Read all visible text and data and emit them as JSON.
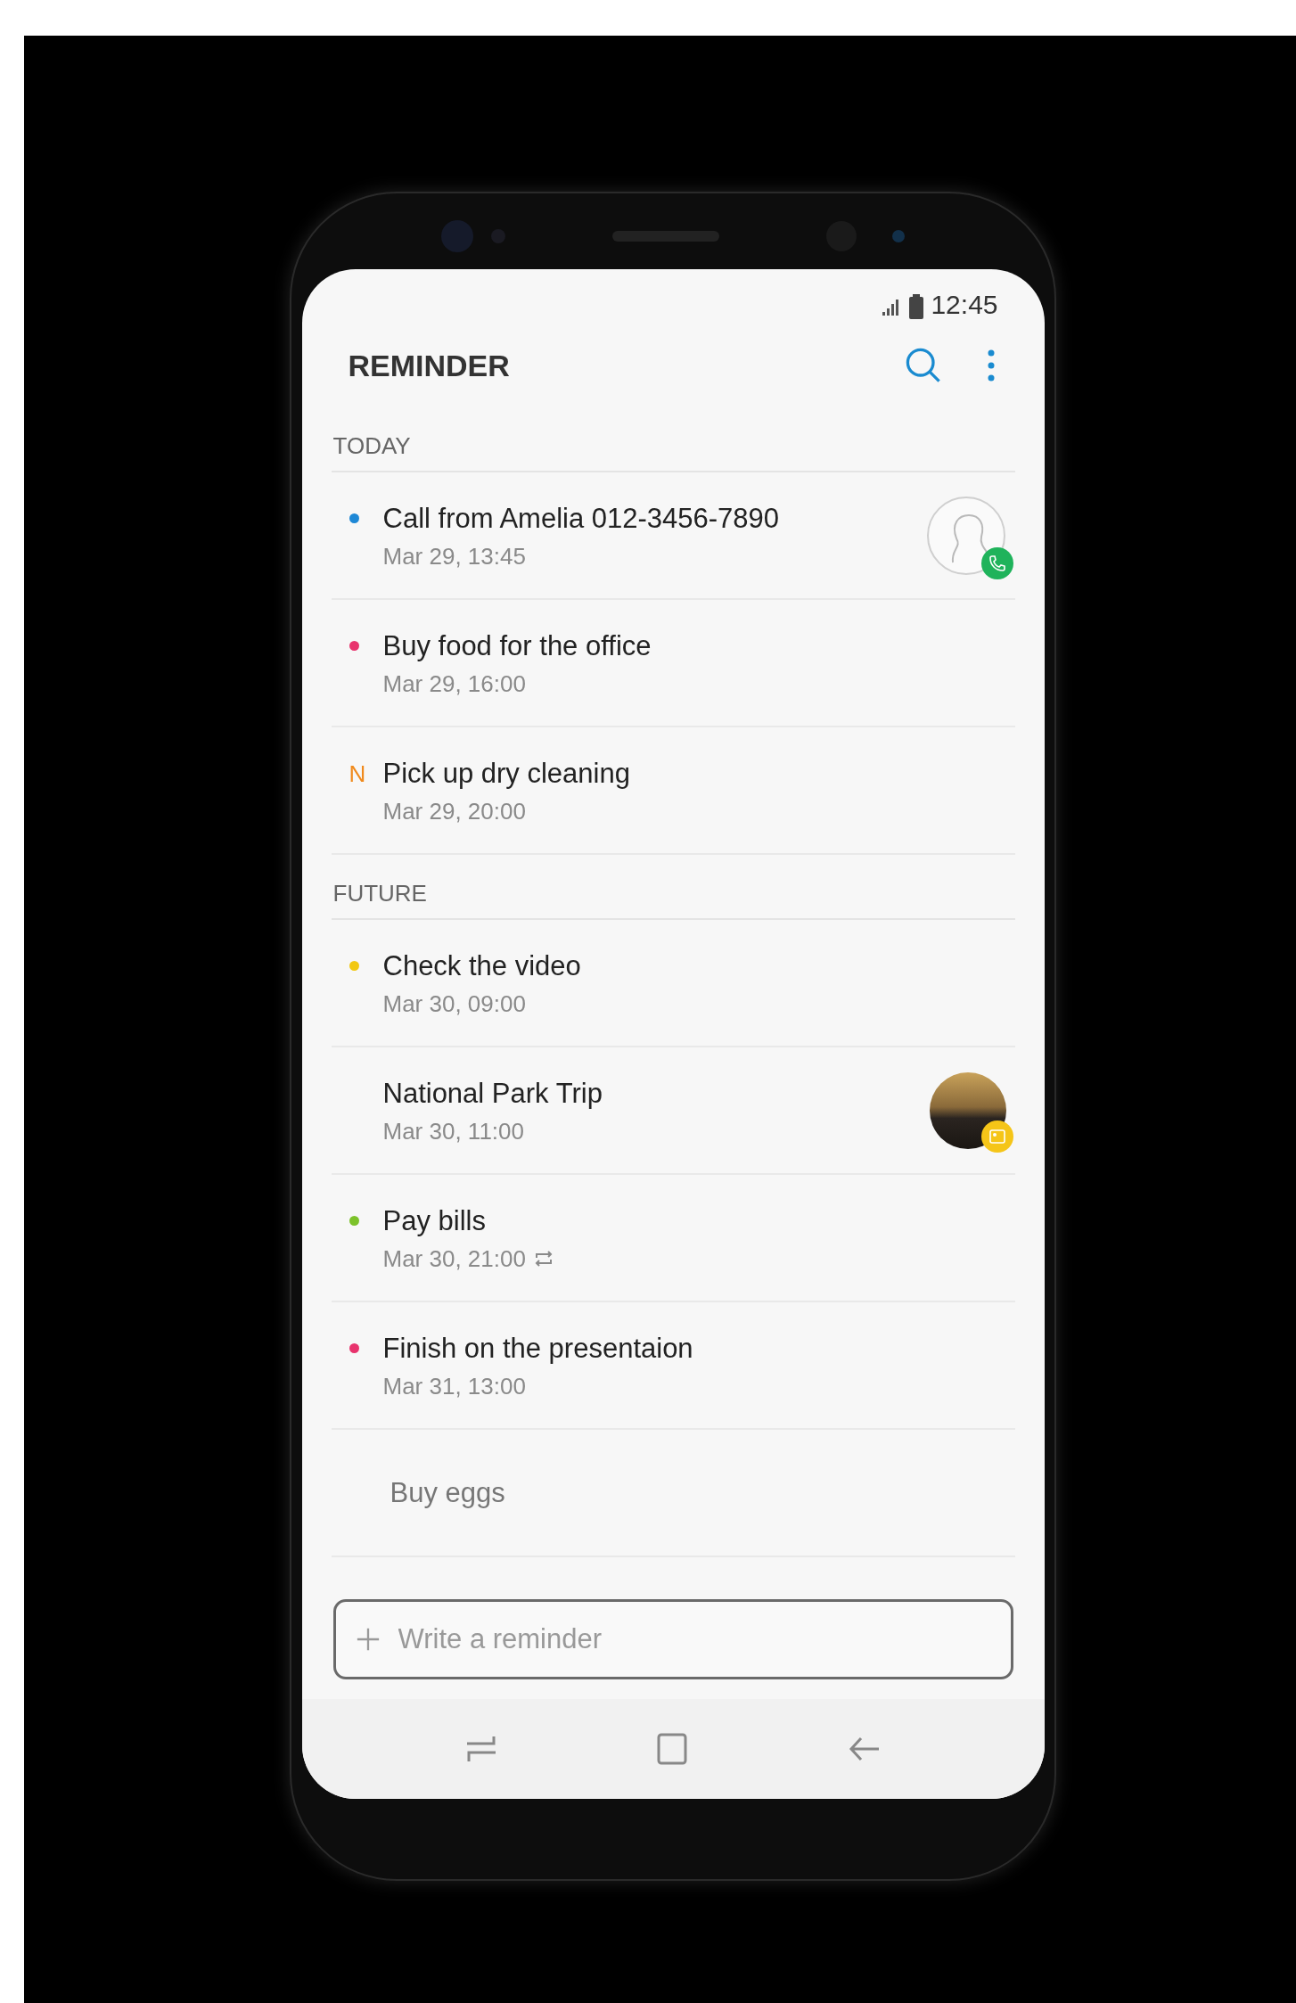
{
  "status_bar": {
    "time": "12:45"
  },
  "app_bar": {
    "title": "REMINDER"
  },
  "sections": [
    {
      "label": "TODAY",
      "items": [
        {
          "title": "Call from Amelia 012-3456-7890",
          "date": "Mar 29, 13:45",
          "marker": {
            "kind": "dot",
            "color": "#1e88d6"
          },
          "attachment": {
            "kind": "contact"
          },
          "repeat": false,
          "faded": false
        },
        {
          "title": "Buy food for the office",
          "date": "Mar 29, 16:00",
          "marker": {
            "kind": "dot",
            "color": "#e8336d"
          },
          "repeat": false,
          "faded": false
        },
        {
          "title": "Pick up dry cleaning",
          "date": "Mar 29, 20:00",
          "marker": {
            "kind": "letter",
            "text": "N",
            "color": "#f08a1c"
          },
          "repeat": false,
          "faded": false
        }
      ]
    },
    {
      "label": "FUTURE",
      "items": [
        {
          "title": "Check the video",
          "date": "Mar 30, 09:00",
          "marker": {
            "kind": "dot",
            "color": "#f2c811"
          },
          "repeat": false,
          "faded": false
        },
        {
          "title": "National Park Trip",
          "date": "Mar 30, 11:00",
          "attachment": {
            "kind": "photo"
          },
          "repeat": false,
          "faded": false
        },
        {
          "title": "Pay bills",
          "date": "Mar 30, 21:00",
          "marker": {
            "kind": "dot",
            "color": "#7cc22a"
          },
          "repeat": true,
          "faded": false
        },
        {
          "title": "Finish on the presentaion",
          "date": "Mar 31, 13:00",
          "marker": {
            "kind": "dot",
            "color": "#e8336d"
          },
          "repeat": false,
          "faded": false
        },
        {
          "title": "Buy eggs",
          "repeat": false,
          "faded": true
        }
      ]
    }
  ],
  "composer": {
    "placeholder": "Write a reminder"
  }
}
